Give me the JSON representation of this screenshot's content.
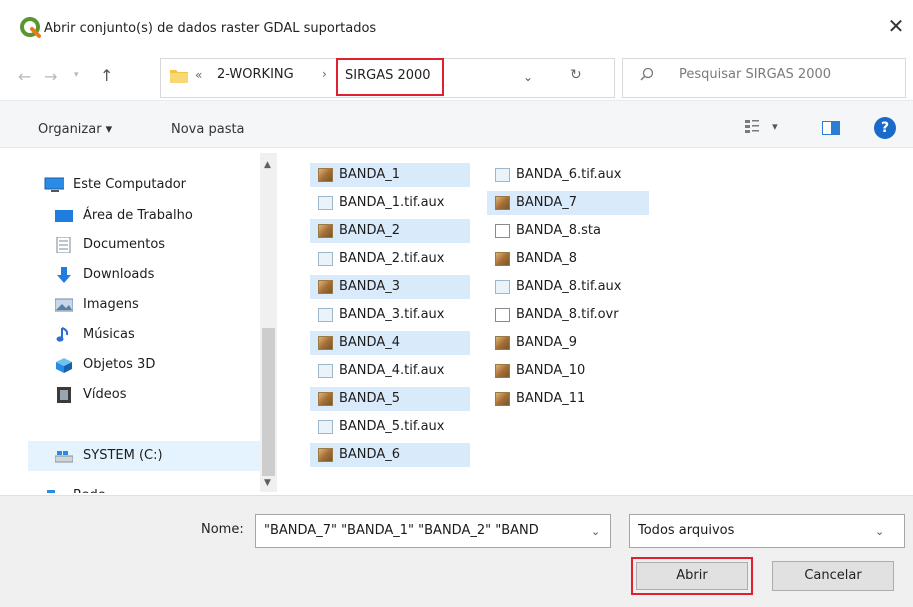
{
  "window": {
    "title": "Abrir conjunto(s) de dados raster GDAL suportados",
    "close_glyph": "✕"
  },
  "address": {
    "prefix": "«",
    "crumbs": [
      "2-WORKING",
      "SIRGAS 2000"
    ],
    "separator": "›",
    "dropdown_glyph": "⌄",
    "refresh_glyph": "↻"
  },
  "search": {
    "placeholder": "Pesquisar SIRGAS 2000"
  },
  "toolbar": {
    "organize_label": "Organizar ▾",
    "new_folder_label": "Nova pasta",
    "view_menu_glyph": "▾",
    "help_glyph": "?"
  },
  "sidebar": {
    "items": [
      {
        "label": "Este Computador",
        "icon": "computer-icon"
      },
      {
        "label": "Área de Trabalho",
        "icon": "desktop-icon"
      },
      {
        "label": "Documentos",
        "icon": "documents-icon"
      },
      {
        "label": "Downloads",
        "icon": "download-icon"
      },
      {
        "label": "Imagens",
        "icon": "images-icon"
      },
      {
        "label": "Músicas",
        "icon": "music-icon"
      },
      {
        "label": "Objetos 3D",
        "icon": "objects-3d-icon"
      },
      {
        "label": "Vídeos",
        "icon": "videos-icon"
      },
      {
        "label": "SYSTEM (C:)",
        "icon": "drive-icon"
      },
      {
        "label": "Rede",
        "icon": "network-icon"
      }
    ],
    "selected": "SYSTEM (C:)"
  },
  "files": {
    "column1": [
      {
        "name": "BANDA_1",
        "type": "raster",
        "selected": true
      },
      {
        "name": "BANDA_1.tif.aux",
        "type": "aux",
        "selected": false
      },
      {
        "name": "BANDA_2",
        "type": "raster",
        "selected": true
      },
      {
        "name": "BANDA_2.tif.aux",
        "type": "aux",
        "selected": false
      },
      {
        "name": "BANDA_3",
        "type": "raster",
        "selected": true
      },
      {
        "name": "BANDA_3.tif.aux",
        "type": "aux",
        "selected": false
      },
      {
        "name": "BANDA_4",
        "type": "raster",
        "selected": true
      },
      {
        "name": "BANDA_4.tif.aux",
        "type": "aux",
        "selected": false
      },
      {
        "name": "BANDA_5",
        "type": "raster",
        "selected": true
      },
      {
        "name": "BANDA_5.tif.aux",
        "type": "aux",
        "selected": false
      },
      {
        "name": "BANDA_6",
        "type": "raster",
        "selected": true
      }
    ],
    "column2": [
      {
        "name": "BANDA_6.tif.aux",
        "type": "aux",
        "selected": false
      },
      {
        "name": "BANDA_7",
        "type": "raster",
        "selected": true
      },
      {
        "name": "BANDA_8.sta",
        "type": "doc",
        "selected": false
      },
      {
        "name": "BANDA_8",
        "type": "raster",
        "selected": false
      },
      {
        "name": "BANDA_8.tif.aux",
        "type": "aux",
        "selected": false
      },
      {
        "name": "BANDA_8.tif.ovr",
        "type": "doc",
        "selected": false
      },
      {
        "name": "BANDA_9",
        "type": "raster",
        "selected": false
      },
      {
        "name": "BANDA_10",
        "type": "raster",
        "selected": false
      },
      {
        "name": "BANDA_11",
        "type": "raster",
        "selected": false
      }
    ]
  },
  "footer": {
    "name_label": "Nome:",
    "name_value": "\"BANDA_7\" \"BANDA_1\" \"BANDA_2\" \"BAND",
    "filter_value": "Todos arquivos",
    "open_label": "Abrir",
    "cancel_label": "Cancelar"
  },
  "colors": {
    "highlight_border": "#e0202e",
    "selection": "#d9ebfb",
    "help_blue": "#1b6ac9"
  }
}
